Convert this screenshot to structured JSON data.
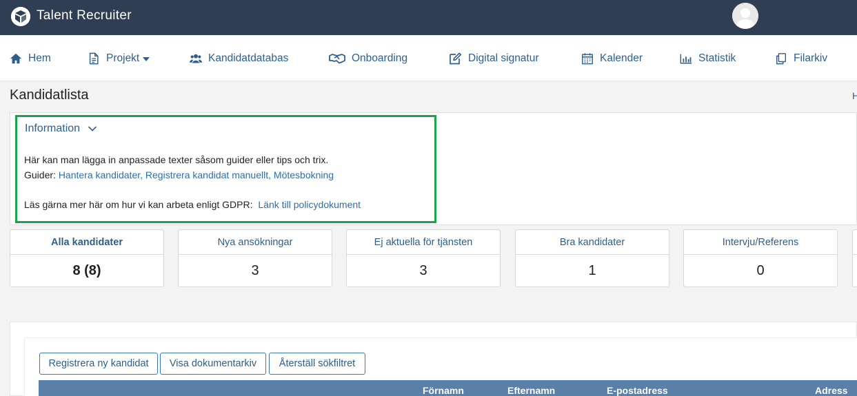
{
  "app": {
    "title": "Talent Recruiter"
  },
  "nav": {
    "items": [
      {
        "label": "Hem",
        "icon": "home-icon"
      },
      {
        "label": "Projekt",
        "icon": "document-icon"
      },
      {
        "label": "Kandidatdatabas",
        "icon": "users-icon"
      },
      {
        "label": "Onboarding",
        "icon": "handshake-icon"
      },
      {
        "label": "Digital signatur",
        "icon": "edit-icon"
      },
      {
        "label": "Kalender",
        "icon": "calendar-icon"
      },
      {
        "label": "Statistik",
        "icon": "bar-chart-icon"
      },
      {
        "label": "Filarkiv",
        "icon": "copy-icon"
      }
    ]
  },
  "page": {
    "title": "Kandidatlista",
    "breadcrumb_stub": "H"
  },
  "info": {
    "title": "Information",
    "line1": "Här kan man lägga in anpassade texter såsom guider eller tips och trix.",
    "guides_label": "Guider:",
    "guide_link1": "Hantera kandidater,",
    "guide_link2": "Registrera kandidat manuellt,",
    "guide_link3": "Mötesbokning",
    "gdpr_text": "Läs gärna mer här om hur vi kan arbeta enligt GDPR:",
    "gdpr_link": "Länk till policydokument"
  },
  "stats": [
    {
      "label": "Alla kandidater",
      "value": "8 (8)",
      "active": true
    },
    {
      "label": "Nya ansökningar",
      "value": "3"
    },
    {
      "label": "Ej aktuella för tjänsten",
      "value": "3"
    },
    {
      "label": "Bra kandidater",
      "value": "1"
    },
    {
      "label": "Intervju/Referens",
      "value": "0"
    }
  ],
  "actions": {
    "register": "Registrera ny kandidat",
    "archive": "Visa dokumentarkiv",
    "reset": "Återställ sökfiltret"
  },
  "table": {
    "columns": [
      "Förnamn",
      "Efternamn",
      "E-postadress",
      "Adress"
    ]
  },
  "colors": {
    "topbar": "#2f3e52",
    "link": "#2d5f8e",
    "highlight_border": "#1aa34a",
    "table_header": "#5b80a8"
  }
}
